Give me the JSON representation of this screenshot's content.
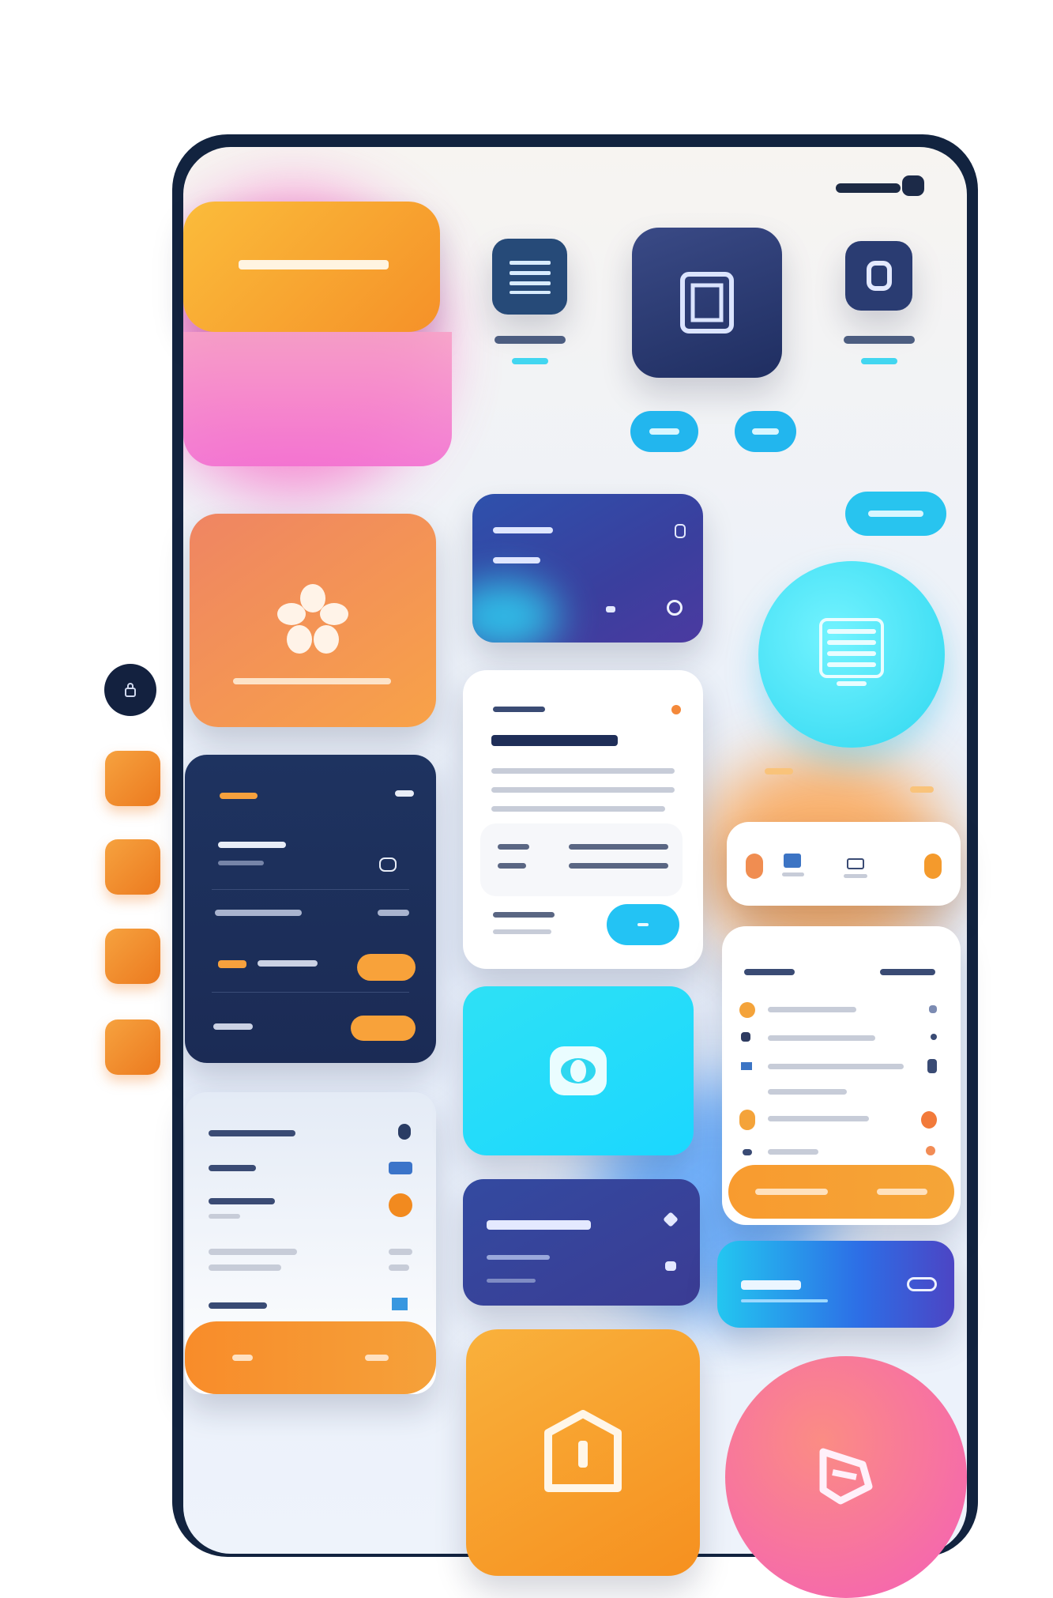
{
  "header": {
    "left_label": "",
    "right_label": ""
  },
  "colors": {
    "navy": "#243a6b",
    "orange": "#f59a2e",
    "cyan": "#22d3ee",
    "pink": "#f45fb3",
    "purple": "#4a3fa0"
  },
  "icons": {
    "menu": "menu-icon",
    "photo": "photo-frame-icon",
    "app": "app-icon",
    "flower": "flower-icon",
    "list": "list-icon",
    "eye": "eye-icon",
    "home": "home-shield-icon",
    "share": "share-icon"
  },
  "badges": {
    "small_icon": "lock-icon"
  }
}
